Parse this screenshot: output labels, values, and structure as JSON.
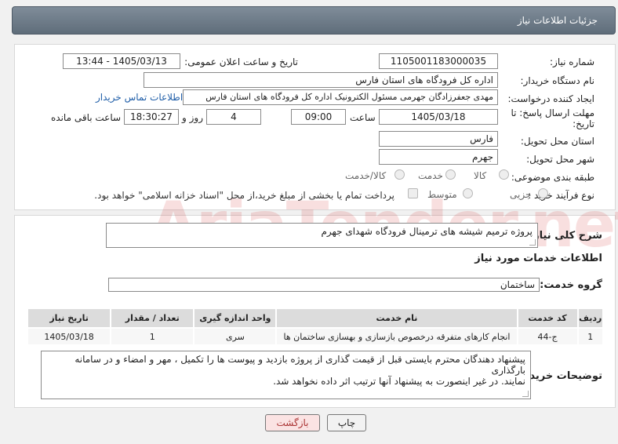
{
  "header": {
    "title": "جزئیات اطلاعات نیاز"
  },
  "form": {
    "need_number_label": "شماره نیاز:",
    "need_number": "1105001183000035",
    "announce_label": "تاریخ و ساعت اعلان عمومی:",
    "announce_value": "1405/03/13 - 13:44",
    "buyer_org_label": "نام دستگاه خریدار:",
    "buyer_org": "اداره کل فرودگاه های استان فارس",
    "requester_label": "ایجاد کننده درخواست:",
    "requester": "مهدی جعفرزادگان جهرمی مسئول الکترونیک اداره کل فرودگاه های استان فارس",
    "contact_link": "اطلاعات تماس خریدار",
    "deadline_label_1": "مهلت ارسال پاسخ: تا",
    "deadline_label_2": "تاریخ:",
    "deadline_date": "1405/03/18",
    "time_label": "ساعت",
    "deadline_time": "09:00",
    "days_value": "4",
    "days_label": "روز و",
    "remaining_time": "18:30:27",
    "remaining_label": "ساعت باقی مانده",
    "province_label": "استان محل تحویل:",
    "province": "فارس",
    "city_label": "شهر محل تحویل:",
    "city": "جهرم",
    "category_label": "طبقه بندی موضوعی:",
    "category_options": [
      "کالا",
      "خدمت",
      "کالا/خدمت"
    ],
    "process_label": "نوع فرآیند خرید :",
    "process_options": [
      "جزیی",
      "متوسط"
    ],
    "payment_note": "پرداخت تمام یا بخشی از مبلغ خرید،از محل \"اسناد خزانه اسلامی\" خواهد بود."
  },
  "summary": {
    "label": "شرح کلی نیاز:",
    "text": "پروژه ترمیم شیشه های ترمینال فرودگاه شهدای جهرم"
  },
  "services": {
    "section_title": "اطلاعات خدمات مورد نیاز",
    "group_label": "گروه خدمت:",
    "group_value": "ساختمان",
    "columns": [
      "ردیف",
      "کد خدمت",
      "نام خدمت",
      "واحد اندازه گیری",
      "تعداد / مقدار",
      "تاریخ نیاز"
    ],
    "rows": [
      [
        "1",
        "ج-44",
        "انجام کارهای متفرقه درخصوص بازسازی و بهسازی ساختمان ها",
        "سری",
        "1",
        "1405/03/18"
      ]
    ]
  },
  "notes": {
    "label": "توضیحات خریدار:",
    "line1": "پیشنهاد دهندگان محترم بایستی قبل از قیمت گذاری از پروژه بازدید و  پیوست ها را تکمیل ، مهر و امضاء و در سامانه بارگذاری",
    "line2": "نمایند. در غیر اینصورت به پیشنهاد آنها ترتیب اثر داده نخواهد شد."
  },
  "buttons": {
    "print": "چاپ",
    "back": "بازگشت"
  },
  "watermark": "AriaTender.net"
}
